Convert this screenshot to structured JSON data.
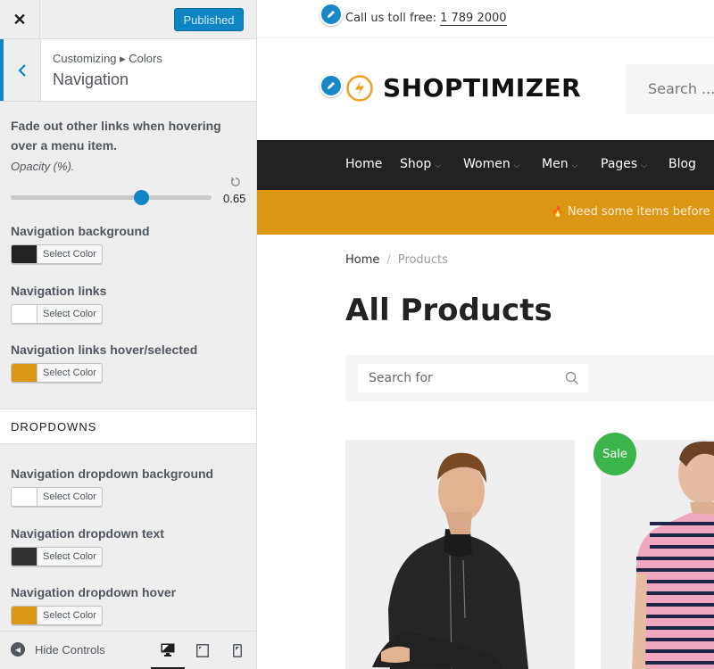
{
  "customizer": {
    "close_label": "✕",
    "publish_label": "Published",
    "breadcrumb": "Customizing ▸ Colors",
    "section_title": "Navigation",
    "fade_control": {
      "label": "Fade out other links when hovering over a menu item.",
      "sublabel": "Opacity (%).",
      "value": 0.65,
      "value_text": "0.65",
      "min": 0,
      "max": 1
    },
    "colors": [
      {
        "label": "Navigation background",
        "button_label": "Select Color",
        "color": "#222222"
      },
      {
        "label": "Navigation links",
        "button_label": "Select Color",
        "color": "#ffffff"
      },
      {
        "label": "Navigation links hover/selected",
        "button_label": "Select Color",
        "color": "#dc9814"
      }
    ],
    "dropdowns_heading": "DROPDOWNS",
    "dropdown_colors": [
      {
        "label": "Navigation dropdown background",
        "button_label": "Select Color",
        "color": "#ffffff"
      },
      {
        "label": "Navigation dropdown text",
        "button_label": "Select Color",
        "color": "#323232"
      },
      {
        "label": "Navigation dropdown hover",
        "button_label": "Select Color",
        "color": "#dc9814"
      }
    ],
    "footer": {
      "hide_controls_label": "Hide Controls",
      "devices": [
        "desktop",
        "tablet",
        "mobile"
      ],
      "active_device": "desktop"
    }
  },
  "preview": {
    "topbar": {
      "call_label": "Call us toll free:",
      "phone": "1 789 2000"
    },
    "logo_text": "SHOPTIMIZER",
    "header_search_placeholder": "Search ...",
    "nav": [
      {
        "label": "Home",
        "has_dropdown": false
      },
      {
        "label": "Shop",
        "has_dropdown": true
      },
      {
        "label": "Women",
        "has_dropdown": true
      },
      {
        "label": "Men",
        "has_dropdown": true
      },
      {
        "label": "Pages",
        "has_dropdown": true
      },
      {
        "label": "Blog",
        "has_dropdown": false
      }
    ],
    "promo_text": "Need some items before t",
    "breadcrumb": {
      "home": "Home",
      "separator": "/",
      "current": "Products"
    },
    "page_title": "All Products",
    "product_search_placeholder": "Search for",
    "sale_badge": "Sale",
    "colors": {
      "accent": "#dc9814",
      "nav_bg": "#222222",
      "sale": "#3bb54a",
      "edit_pin": "#1a88c8",
      "publish": "#0f86c4"
    }
  }
}
